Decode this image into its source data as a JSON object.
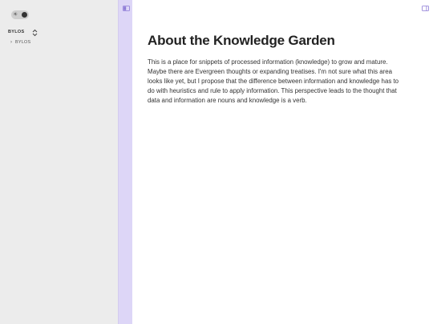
{
  "sidebar": {
    "vault_name": "BYLOS",
    "tree_items": [
      {
        "label": "BYLOS",
        "expanded": false
      }
    ]
  },
  "main": {
    "title": "About the Knowledge Garden",
    "body": "This is a place for snippets of processed information (knowledge) to grow and mature. Maybe there are Evergreen thoughts or expanding treatises. I'm not sure what this area looks like yet, but I propose that the difference between information and knowledge has to do with heuristics and rule to apply information. This perspective leads to the thought that data and information are nouns and knowledge is a verb."
  },
  "colors": {
    "ribbon": "#ddd6f7",
    "accent_icon": "#8c7ad6",
    "sidebar_bg": "#ececec",
    "content_bg": "#ffffff"
  },
  "icons": {
    "theme_toggle": "sun-icon",
    "vault_switcher": "chevron-up-down-icon",
    "left_panel": "sidebar-left-icon",
    "right_panel": "sidebar-right-icon",
    "tree_chevron": "chevron-right-icon"
  }
}
